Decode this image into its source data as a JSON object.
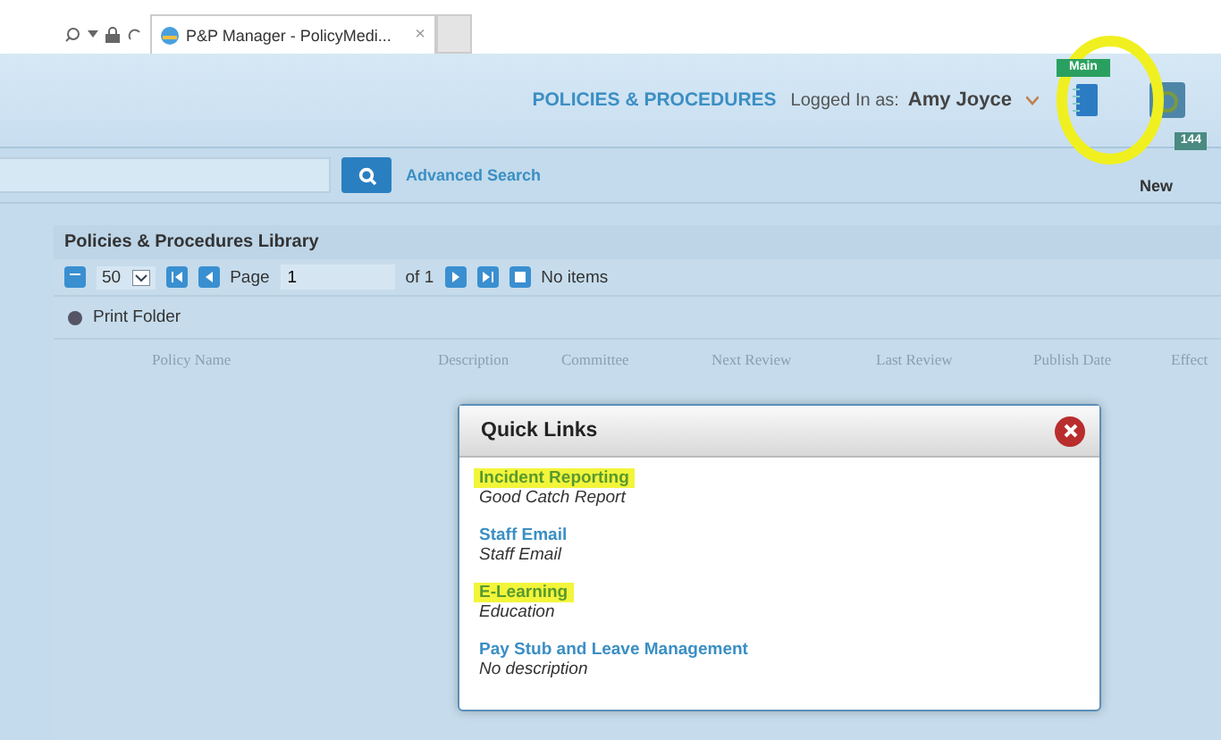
{
  "browser": {
    "tab": {
      "title": "P&P Manager - PolicyMedi...",
      "close": "×",
      "selected": true
    }
  },
  "header": {
    "title": "POLICIES & PROCEDURES",
    "logged_in_label": "Logged In as:",
    "user": "Amy Joyce",
    "main_badge": "Main",
    "count_badge": "144",
    "new_label": "New"
  },
  "search": {
    "advanced": "Advanced Search"
  },
  "library": {
    "title": "Policies & Procedures Library",
    "page_size": "50",
    "page_label": "Page",
    "page": "1",
    "page_count": "of 1",
    "status": "No items",
    "print_folder": "Print Folder",
    "columns": [
      "Policy Name",
      "Description",
      "Committee",
      "Next Review",
      "Last Review",
      "Publish Date",
      "Effect"
    ]
  },
  "quick_links": {
    "title": "Quick Links",
    "items": [
      {
        "name": "Incident Reporting",
        "description": "Good Catch Report",
        "highlighted": true
      },
      {
        "name": "Staff Email",
        "description": "Staff Email",
        "highlighted": false
      },
      {
        "name": "E-Learning",
        "description": "Education",
        "highlighted": true
      },
      {
        "name": "Pay Stub and Leave Management",
        "description": "No description",
        "highlighted": false
      }
    ]
  }
}
